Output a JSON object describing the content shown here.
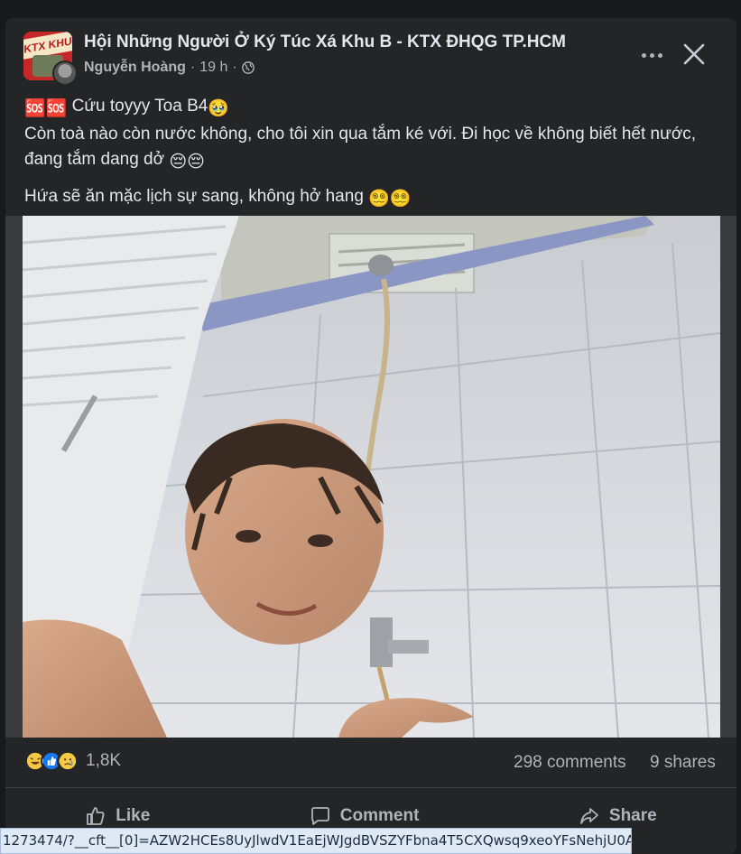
{
  "post": {
    "group_name": "Hội Những Người Ở Ký Túc Xá Khu B - KTX ĐHQG TP.HCM",
    "group_avatar_text": "KTX KHU B",
    "author": "Nguyễn Hoàng",
    "separator": "·",
    "time": "19 h",
    "text_line1_prefix": "🆘🆘",
    "text_line1": "Cứu toyyy Toa B4",
    "text_line1_emoji": "🥹",
    "text_line2": "Còn toà nào còn nước không, cho tôi xin qua tắm ké với. Đi học về không biết hết nước, đang tắm dang dở",
    "text_line2_emoji": "😔😔",
    "text_line3": "Hứa sẽ ăn mặc lịch sự sang, không hở hang",
    "text_line3_emoji": "😵‍💫😵‍💫"
  },
  "stats": {
    "reaction_count": "1,8K",
    "comments": "298 comments",
    "shares": "9 shares"
  },
  "actions": {
    "like": "Like",
    "comment": "Comment",
    "share": "Share"
  },
  "status_bar": {
    "url": "1273474/?__cft__[0]=AZW2HCEs8UyJlwdV1EaEjWJgdBVSZYFbna4T5CXQwsq9xeoYFsNehjU0A..."
  },
  "colors": {
    "card_bg": "#242526",
    "page_bg": "#18191a",
    "text_primary": "#e4e6eb",
    "text_secondary": "#b0b3b8"
  }
}
